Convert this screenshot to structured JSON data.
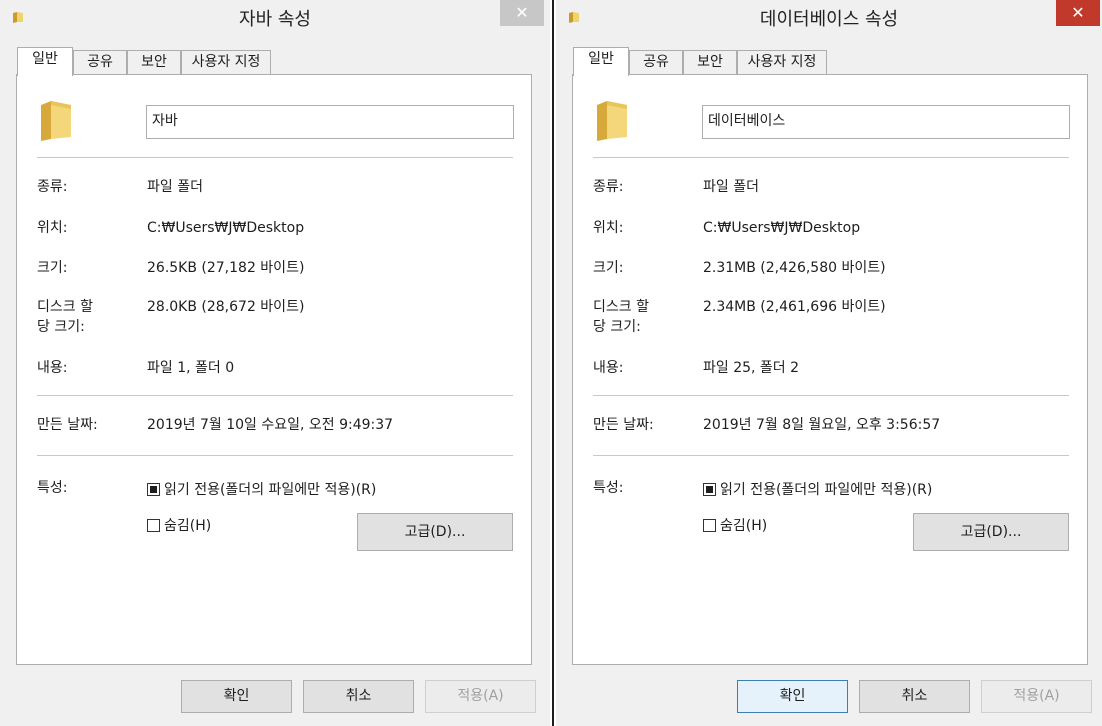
{
  "windows": [
    {
      "title": "자바 속성",
      "close_glyph": "✕",
      "tabs": [
        "일반",
        "공유",
        "보안",
        "사용자 지정"
      ],
      "name_value": "자바",
      "type_label": "종류:",
      "type_value": "파일 폴더",
      "location_label": "위치:",
      "location_value": "C:₩Users₩J₩Desktop",
      "size_label": "크기:",
      "size_value": "26.5KB (27,182 바이트)",
      "disk_label_1": "디스크 할",
      "disk_label_2": "당 크기:",
      "disk_value": "28.0KB (28,672 바이트)",
      "contents_label": "내용:",
      "contents_value": "파일 1, 폴더 0",
      "created_label": "만든 날짜:",
      "created_value": "2019년 7월 10일 수요일, 오전 9:49:37",
      "attributes_label": "특성:",
      "readonly_label": "읽기 전용(폴더의 파일에만 적용)(R)",
      "hidden_label": "숨김(H)",
      "advanced_label": "고급(D)...",
      "ok_label": "확인",
      "cancel_label": "취소",
      "apply_label": "적용(A)"
    },
    {
      "title": "데이터베이스 속성",
      "close_glyph": "✕",
      "tabs": [
        "일반",
        "공유",
        "보안",
        "사용자 지정"
      ],
      "name_value": "데이터베이스",
      "type_label": "종류:",
      "type_value": "파일 폴더",
      "location_label": "위치:",
      "location_value": "C:₩Users₩J₩Desktop",
      "size_label": "크기:",
      "size_value": "2.31MB (2,426,580 바이트)",
      "disk_label_1": "디스크 할",
      "disk_label_2": "당 크기:",
      "disk_value": "2.34MB (2,461,696 바이트)",
      "contents_label": "내용:",
      "contents_value": "파일 25, 폴더 2",
      "created_label": "만든 날짜:",
      "created_value": "2019년 7월 8일 월요일, 오후 3:56:57",
      "attributes_label": "특성:",
      "readonly_label": "읽기 전용(폴더의 파일에만 적용)(R)",
      "hidden_label": "숨김(H)",
      "advanced_label": "고급(D)...",
      "ok_label": "확인",
      "cancel_label": "취소",
      "apply_label": "적용(A)"
    }
  ],
  "icons": [
    "folder-icon"
  ],
  "colors": {
    "close_active": "#c0392b",
    "window_bg": "#f0f0f0"
  }
}
